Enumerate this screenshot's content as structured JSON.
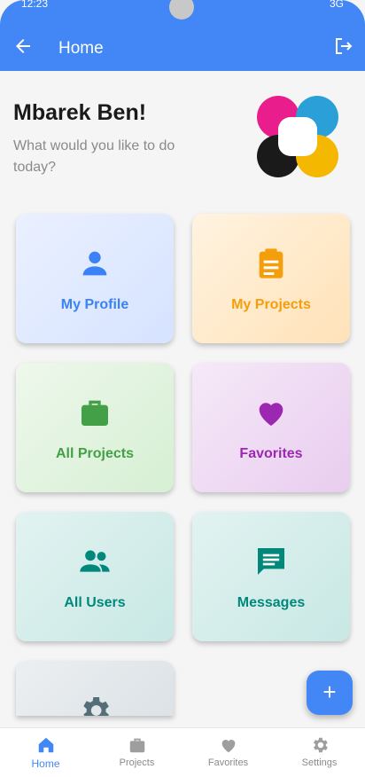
{
  "status_bar": {
    "time": "12:23",
    "network": "3G"
  },
  "app_bar": {
    "title": "Home",
    "back_icon": "arrow-left-icon",
    "logout_icon": "logout-icon"
  },
  "greeting": {
    "name": "Mbarek Ben!",
    "subtitle": "What would you like to do today?"
  },
  "cards": [
    {
      "label": "My Profile",
      "icon": "person-icon",
      "color": "#3b82f6"
    },
    {
      "label": "My Projects",
      "icon": "clipboard-icon",
      "color": "#f59e0b"
    },
    {
      "label": "All Projects",
      "icon": "briefcase-icon",
      "color": "#43a047"
    },
    {
      "label": "Favorites",
      "icon": "heart-icon",
      "color": "#9c27b0"
    },
    {
      "label": "All Users",
      "icon": "people-icon",
      "color": "#00897b"
    },
    {
      "label": "Messages",
      "icon": "message-icon",
      "color": "#00897b"
    },
    {
      "label": "",
      "icon": "settings-icon",
      "color": "#546e7a"
    }
  ],
  "fab": {
    "label": "+"
  },
  "bottom_nav": [
    {
      "label": "Home",
      "icon": "home-icon",
      "active": true
    },
    {
      "label": "Projects",
      "icon": "briefcase-icon",
      "active": false
    },
    {
      "label": "Favorites",
      "icon": "heart-icon",
      "active": false
    },
    {
      "label": "Settings",
      "icon": "settings-icon",
      "active": false
    }
  ],
  "colors": {
    "primary": "#4287f5",
    "background": "#f5f5f5"
  }
}
